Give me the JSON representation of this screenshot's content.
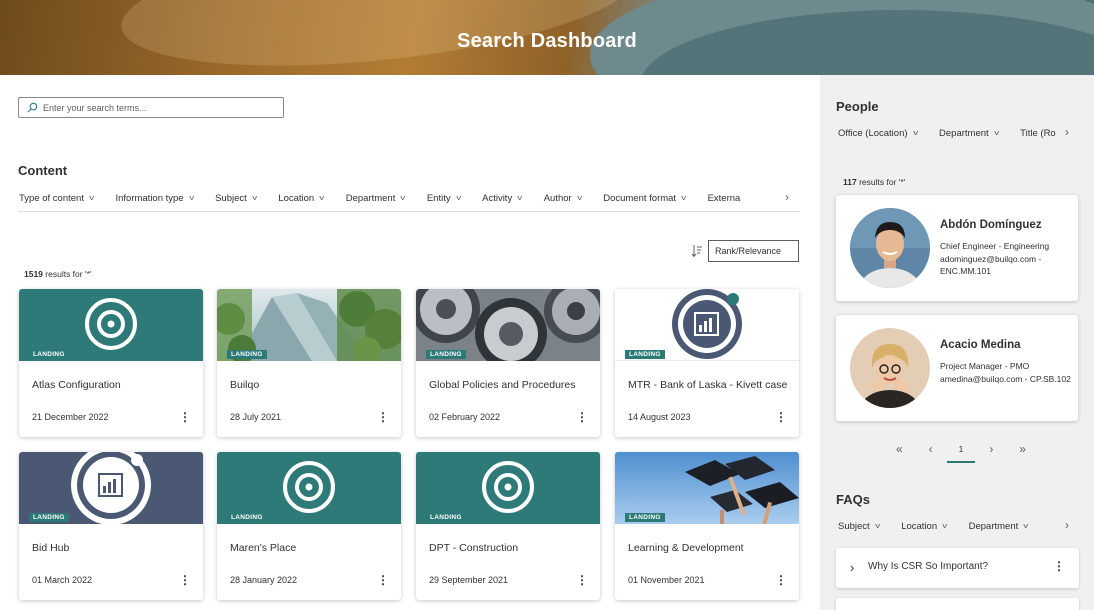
{
  "header": {
    "title": "Search Dashboard"
  },
  "search": {
    "placeholder": "Enter your search terms..."
  },
  "content": {
    "title": "Content",
    "filters": [
      "Type of content",
      "Information type",
      "Subject",
      "Location",
      "Department",
      "Entity",
      "Activity",
      "Author",
      "Document format",
      "Externa"
    ],
    "sort_label": "Rank/Relevance",
    "results_count": "1519",
    "results_text": " results for '*'",
    "badge": "LANDING",
    "cards": [
      {
        "title": "Atlas Configuration",
        "date": "21 December 2022",
        "thumb": "target-icon",
        "bg": "#2e7a78"
      },
      {
        "title": "Builqo",
        "date": "28 July 2021",
        "thumb": "glass-building-photo",
        "bg": "#8fb3a0"
      },
      {
        "title": "Global Policies and Procedures",
        "date": "02 February 2022",
        "thumb": "gears-photo",
        "bg": "#6b7278"
      },
      {
        "title": "MTR - Bank of Laska - Kivett case",
        "date": "14 August 2023",
        "thumb": "chart-ring-icon",
        "bg": "#ffffff"
      },
      {
        "title": "Bid Hub",
        "date": "01 March 2022",
        "thumb": "chart-ring-icon",
        "bg": "#4a5873"
      },
      {
        "title": "Maren's Place",
        "date": "28 January 2022",
        "thumb": "target-icon",
        "bg": "#2e7a78"
      },
      {
        "title": "DPT - Construction",
        "date": "29 September 2021",
        "thumb": "target-icon",
        "bg": "#2e7a78"
      },
      {
        "title": "Learning & Development",
        "date": "01 November 2021",
        "thumb": "graduation-caps-photo",
        "bg": "#6aa3d8"
      }
    ]
  },
  "people": {
    "title": "People",
    "filters": [
      "Office (Location)",
      "Department",
      "Title (Ro"
    ],
    "results_count": "117",
    "results_text": " results for '*'",
    "persons": [
      {
        "name": "Abdón Domínguez",
        "role": "Chief Engineer - Engineering",
        "contact": "adominguez@builqo.com - ENC.MM.101"
      },
      {
        "name": "Acacio Medina",
        "role": "Project Manager - PMO",
        "contact": "amedina@builqo.com - CP.SB.102"
      }
    ],
    "pager": {
      "page": "1",
      "first": "«",
      "prev": "‹",
      "next": "›",
      "last": "»"
    }
  },
  "faqs": {
    "title": "FAQs",
    "filters": [
      "Subject",
      "Location",
      "Department"
    ],
    "items": [
      {
        "question": "Why Is CSR So Important?"
      }
    ]
  },
  "colors": {
    "accent": "#2b7a78",
    "navy": "#4a5873",
    "sidebar_bg": "#f0f0f0"
  }
}
